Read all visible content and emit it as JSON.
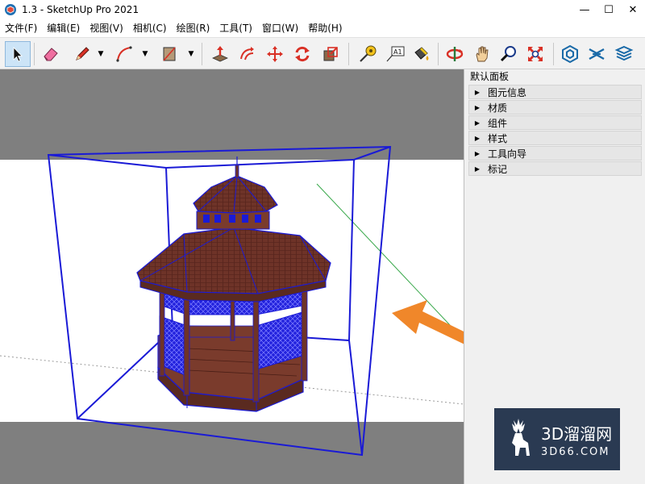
{
  "window": {
    "title": "1.3 - SketchUp Pro 2021",
    "controls": {
      "minimize": "—",
      "maximize": "☐",
      "close": "✕"
    }
  },
  "menu": [
    "文件(F)",
    "编辑(E)",
    "视图(V)",
    "相机(C)",
    "绘图(R)",
    "工具(T)",
    "窗口(W)",
    "帮助(H)"
  ],
  "toolbar": {
    "tools": [
      {
        "icon": "select-arrow-icon",
        "active": true
      },
      {
        "icon": "eraser-icon"
      },
      {
        "icon": "pencil-line-icon",
        "dropdown": true
      },
      {
        "icon": "arc-icon",
        "dropdown": true
      },
      {
        "icon": "rectangle-icon",
        "dropdown": true
      },
      {
        "icon": "push-pull-icon"
      },
      {
        "icon": "offset-icon"
      },
      {
        "icon": "move-icon"
      },
      {
        "icon": "rotate-icon"
      },
      {
        "icon": "scale-icon"
      },
      {
        "icon": "tape-measure-icon"
      },
      {
        "icon": "text-label-icon"
      },
      {
        "icon": "paint-bucket-icon"
      },
      {
        "icon": "orbit-icon"
      },
      {
        "icon": "pan-hand-icon"
      },
      {
        "icon": "zoom-icon"
      },
      {
        "icon": "zoom-extents-icon"
      },
      {
        "icon": "warehouse-icon"
      },
      {
        "icon": "extension-icon"
      },
      {
        "icon": "layers-stack-icon"
      }
    ],
    "text_tool_label": "A1"
  },
  "tray": {
    "title": "默认面板",
    "items": [
      {
        "label": "图元信息"
      },
      {
        "label": "材质"
      },
      {
        "label": "组件"
      },
      {
        "label": "样式"
      },
      {
        "label": "工具向导"
      },
      {
        "label": "标记"
      }
    ]
  },
  "watermark": {
    "brand": "3D溜溜网",
    "site": "3D66.COM"
  },
  "colors": {
    "selection": "#1a1ad6",
    "wood": "#6e3328",
    "annotation_arrow": "#f0872a",
    "viewport_bg": "#7f7f7f",
    "canvas_white": "#ffffff"
  }
}
